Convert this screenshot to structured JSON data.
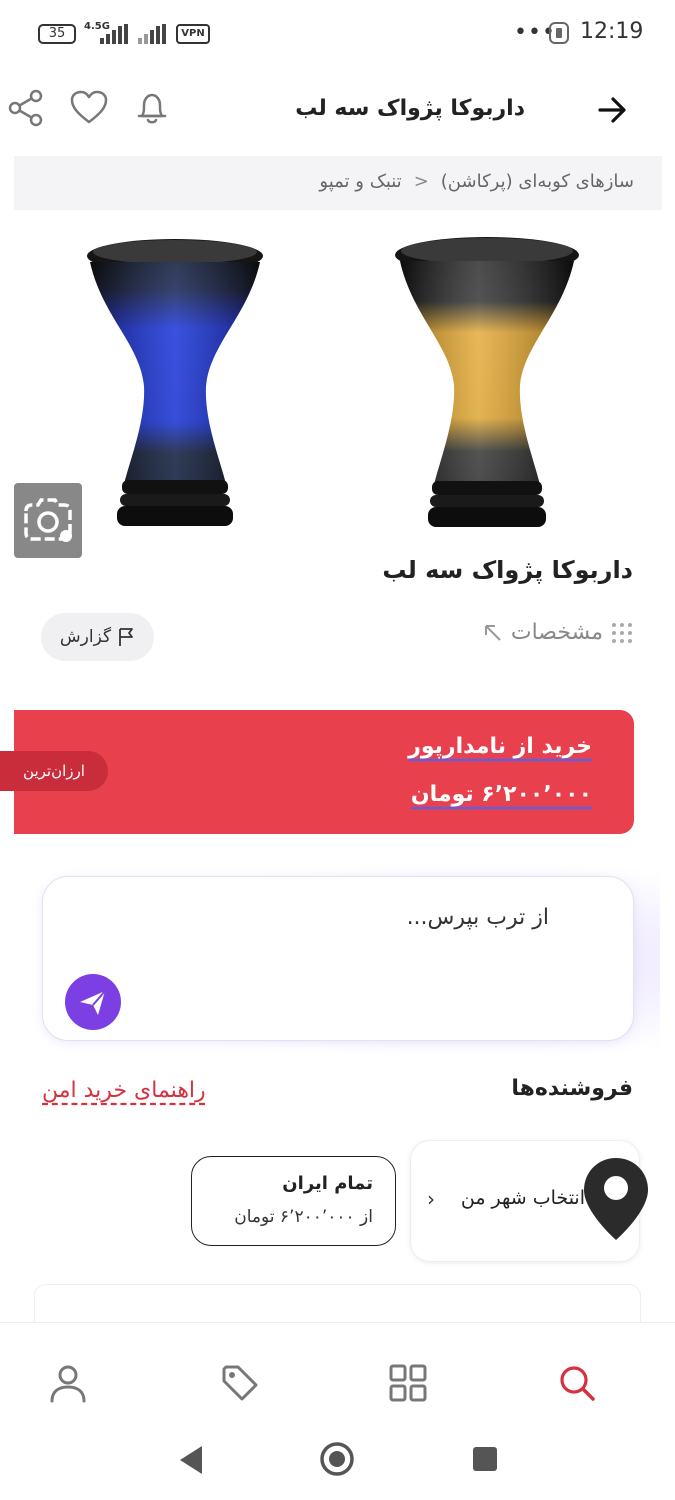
{
  "status_bar": {
    "battery": "35",
    "network": "4.5G",
    "vpn": "VPN",
    "more": "•••",
    "time": "12:19"
  },
  "header": {
    "title": "داربوکا پژواک سه لب",
    "back_icon": "arrow-right-icon",
    "icons": [
      "bell-icon",
      "heart-icon",
      "share-icon"
    ]
  },
  "breadcrumb": {
    "items": [
      "سازهای کوبه‌ای (پرکاشن)",
      "تنبک و تمپو"
    ],
    "separator": "<"
  },
  "product": {
    "title": "داربوکا پژواک سه لب",
    "images": [
      "gold-black darbuka",
      "blue-black darbuka"
    ],
    "specs_label": "مشخصات",
    "report_label": "گزارش"
  },
  "buy": {
    "line1": "خرید از نامدارپور",
    "line2": "۶٬۲۰۰٬۰۰۰ تومان",
    "badge": "ارزان‌ترین",
    "color": "#e8404d"
  },
  "ask": {
    "placeholder": "از ترب بپرس..."
  },
  "sellers": {
    "heading": "فروشنده‌ها",
    "guide_link": "راهنمای خرید امن",
    "city_select": "انتخاب شهر من",
    "iran_title": "تمام ایران",
    "iran_price": "از ۶٬۲۰۰٬۰۰۰ تومان"
  },
  "bottom_nav": [
    "search-icon",
    "grid-icon",
    "tag-icon",
    "user-icon"
  ],
  "colors": {
    "accent": "#d6313f",
    "purple": "#7b3fe4"
  }
}
